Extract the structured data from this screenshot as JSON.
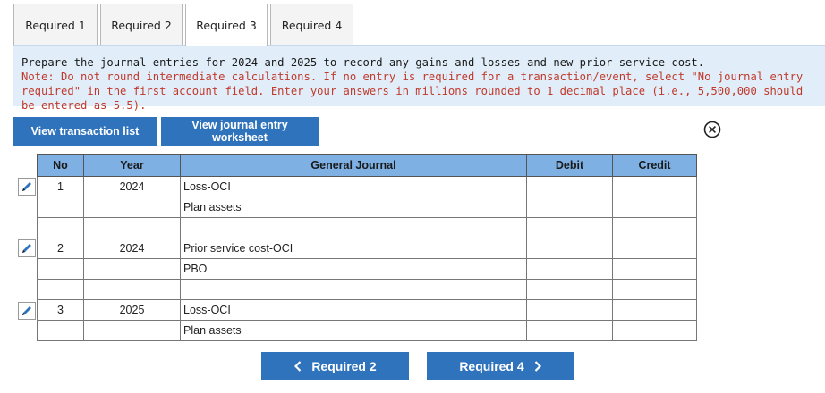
{
  "tabs": [
    {
      "label": "Required 1",
      "active": false
    },
    {
      "label": "Required 2",
      "active": false
    },
    {
      "label": "Required 3",
      "active": true
    },
    {
      "label": "Required 4",
      "active": false
    }
  ],
  "instructions": {
    "main": "Prepare the journal entries for 2024 and 2025 to record any gains and losses and new prior service cost.",
    "note": "Note: Do not round intermediate calculations. If no entry is required for a transaction/event, select \"No journal entry required\" in the first account field. Enter your answers in millions rounded to 1 decimal place (i.e., 5,500,000 should be entered as 5.5)."
  },
  "buttons": {
    "view_transaction_list": "View transaction list",
    "view_journal_entry_worksheet": "View journal entry worksheet",
    "prev": "Required 2",
    "next": "Required 4"
  },
  "table": {
    "headers": [
      "No",
      "Year",
      "General Journal",
      "Debit",
      "Credit"
    ],
    "rows": [
      {
        "no": "1",
        "year": "2024",
        "account": "Loss-OCI",
        "debit": "",
        "credit": ""
      },
      {
        "no": "",
        "year": "",
        "account": "Plan assets",
        "debit": "",
        "credit": ""
      },
      {
        "no": "",
        "year": "",
        "account": "",
        "debit": "",
        "credit": ""
      },
      {
        "no": "2",
        "year": "2024",
        "account": "Prior service cost-OCI",
        "debit": "",
        "credit": ""
      },
      {
        "no": "",
        "year": "",
        "account": "PBO",
        "debit": "",
        "credit": ""
      },
      {
        "no": "",
        "year": "",
        "account": "",
        "debit": "",
        "credit": ""
      },
      {
        "no": "3",
        "year": "2025",
        "account": "Loss-OCI",
        "debit": "",
        "credit": ""
      },
      {
        "no": "",
        "year": "",
        "account": "Plan assets",
        "debit": "",
        "credit": ""
      }
    ]
  },
  "icons": {
    "edit": "pencil-icon",
    "close": "close-circle-icon",
    "prev": "chevron-left-icon",
    "next": "chevron-right-icon"
  },
  "colors": {
    "accent": "#2f73bd",
    "header": "#7eb0e3",
    "instructions_bg": "#e1eef9",
    "note": "#c0392b"
  }
}
